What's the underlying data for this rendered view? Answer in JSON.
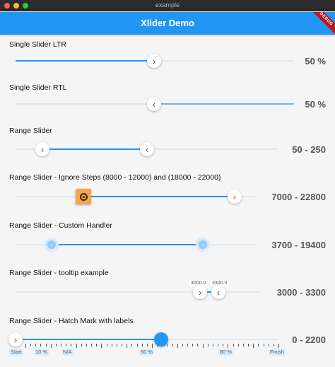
{
  "window": {
    "title": "example"
  },
  "appbar": {
    "title": "Xlider Demo",
    "debug_banner": "DEBUG"
  },
  "colors": {
    "primary": "#2196f3",
    "rail": "#dde7f3",
    "handler_orange": "#f5a64a",
    "arrow_red": "#e53935"
  },
  "sliders": {
    "ltr": {
      "label": "Single Slider LTR",
      "value": "50 %",
      "fraction": 0.5
    },
    "rtl": {
      "label": "Single Slider RTL",
      "value": "50 %",
      "fraction": 0.5
    },
    "range": {
      "label": "Range Slider",
      "value": "50 - 250"
    },
    "ignore": {
      "label": "Range Slider - Ignore Steps (8000 - 12000) and (18000 - 22000)",
      "value": "7000 - 22800"
    },
    "custom": {
      "label": "Range Slider - Custom Handler",
      "value": "3700 - 19400"
    },
    "tooltip": {
      "label": "Range Slider - tooltip example",
      "value": "3000 - 3300",
      "tip_lower": "3000.0",
      "tip_upper": "3300.0"
    },
    "hatch": {
      "label": "Range Slider - Hatch Mark with labels",
      "value": "0 - 2200",
      "hatch_labels": [
        "Start",
        "10 %",
        "N/A",
        "50 %",
        "80 %",
        "Finish"
      ]
    }
  },
  "icons": {
    "thumb_right": "chevron-right-icon",
    "thumb_left": "chevron-left-icon",
    "custom": "target-icon"
  }
}
